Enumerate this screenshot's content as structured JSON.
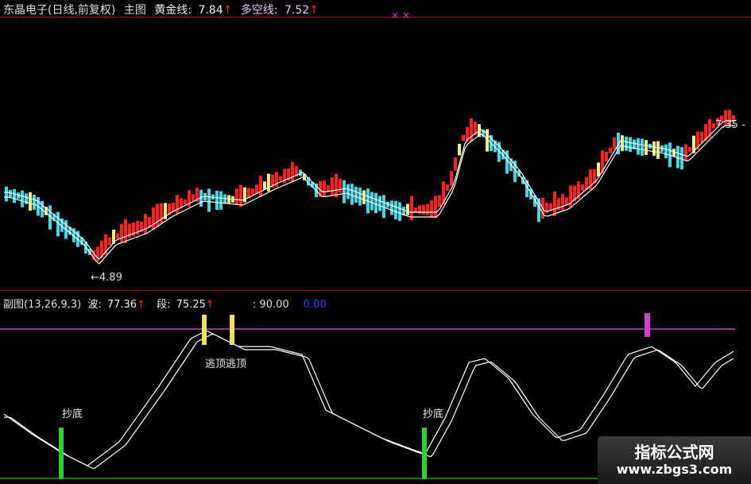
{
  "header": {
    "stock_name": "东晶电子(日线,前复权)",
    "main_label": "主图",
    "gold_line_label": "黄金线:",
    "gold_line_value": "7.84",
    "longshort_line_label": "多空线:",
    "longshort_line_value": "7.52",
    "up_arrow": "↑"
  },
  "main_chart": {
    "low_marker": "←4.89",
    "high_marker": "7.35 -",
    "cross_marks": "× ×"
  },
  "sub_header": {
    "name": "副图(13,26,9,3)",
    "wave_label": "波:",
    "wave_value": "77.36",
    "segment_label": "段:",
    "segment_value": "75.25",
    "upper_value": ": 90.00",
    "lower_value": "0.00"
  },
  "sub_chart": {
    "bottom_label": "抄底",
    "bottom_label_2": "抄底",
    "escape_label": "逃顶逃顶"
  },
  "watermark": {
    "title": "指标公式网",
    "url": "www.zbgs3.com"
  },
  "colors": {
    "up": "#ff2020",
    "down": "#40d8e8",
    "yellow": "#f0f080",
    "line": "#ffffff",
    "purple_line": "#c040c0",
    "bottom_bar": "#30d030",
    "escape_bar": "#f0e060",
    "purple_bar": "#d040d0"
  }
}
